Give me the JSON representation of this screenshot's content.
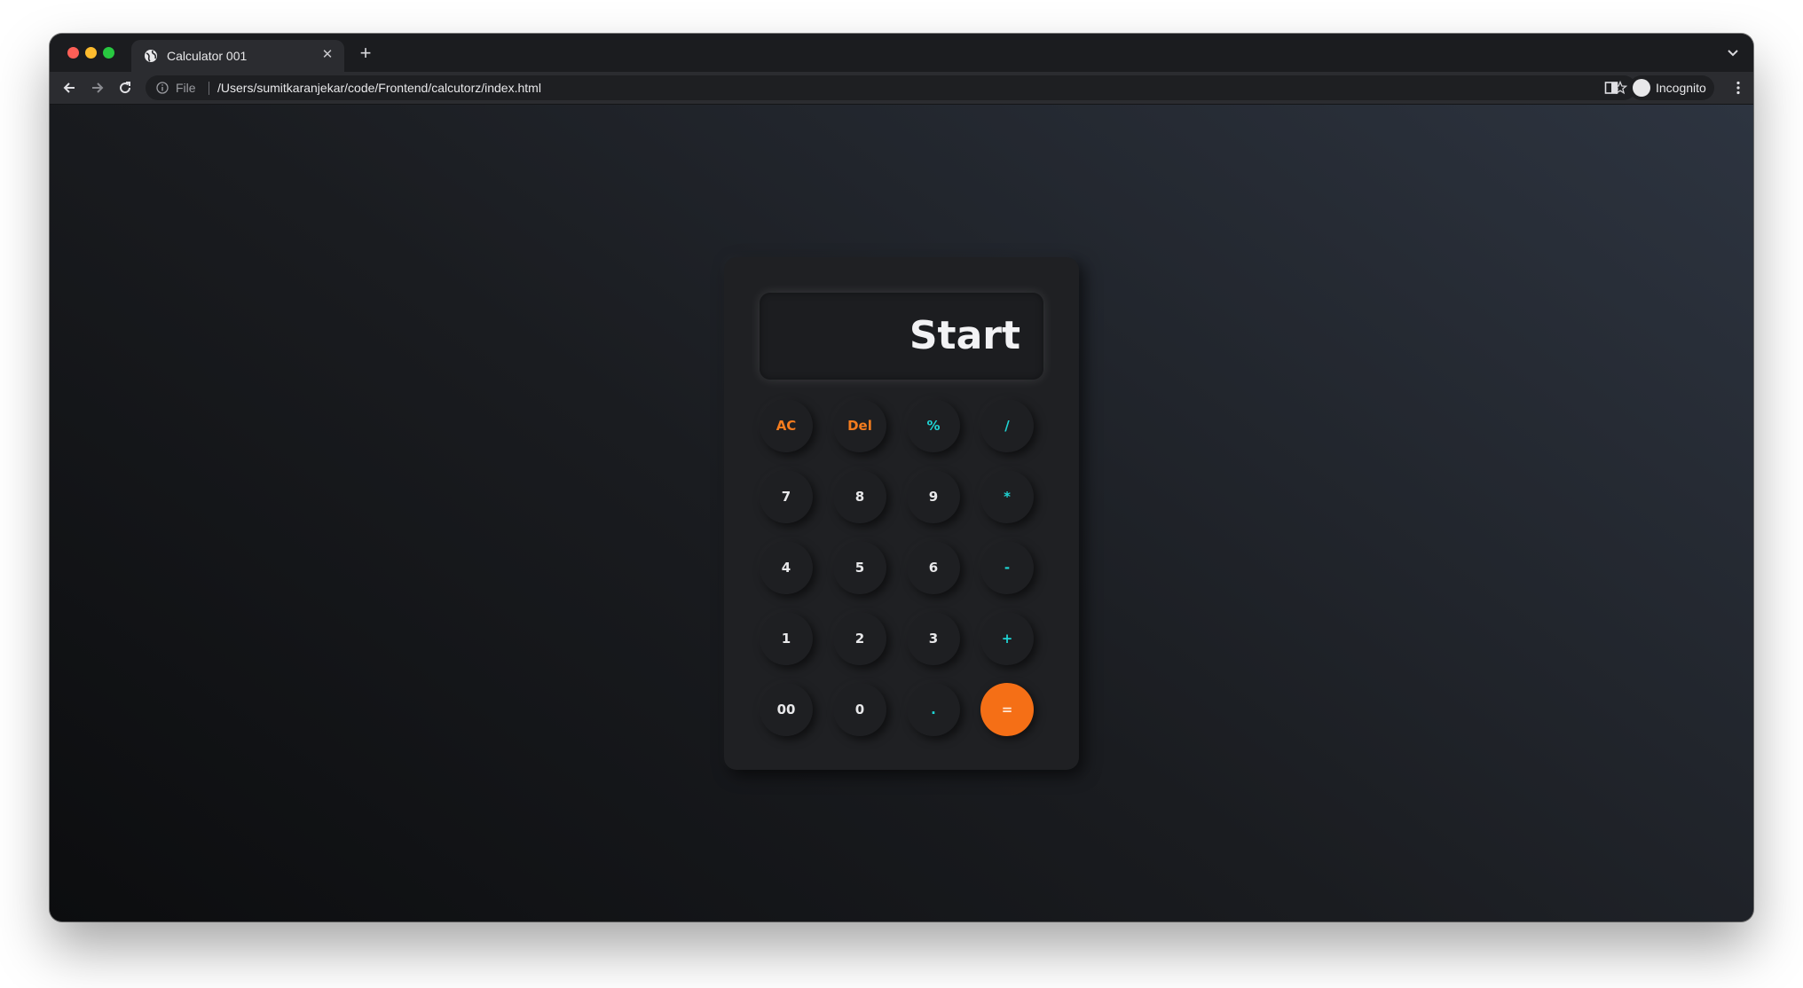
{
  "browser": {
    "tab_title": "Calculator 001",
    "file_label": "File",
    "url": "/Users/sumitkaranjekar/code/Frontend/calcutorz/index.html",
    "profile_label": "Incognito"
  },
  "calculator": {
    "display": "Start",
    "keys": [
      [
        "AC",
        "Del",
        "%",
        "/"
      ],
      [
        "7",
        "8",
        "9",
        "*"
      ],
      [
        "4",
        "5",
        "6",
        "-"
      ],
      [
        "1",
        "2",
        "3",
        "+"
      ],
      [
        "00",
        "0",
        ".",
        "="
      ]
    ],
    "colors": {
      "accent_orange": "#f56f16",
      "operator_cyan": "#1fd4d4"
    }
  }
}
